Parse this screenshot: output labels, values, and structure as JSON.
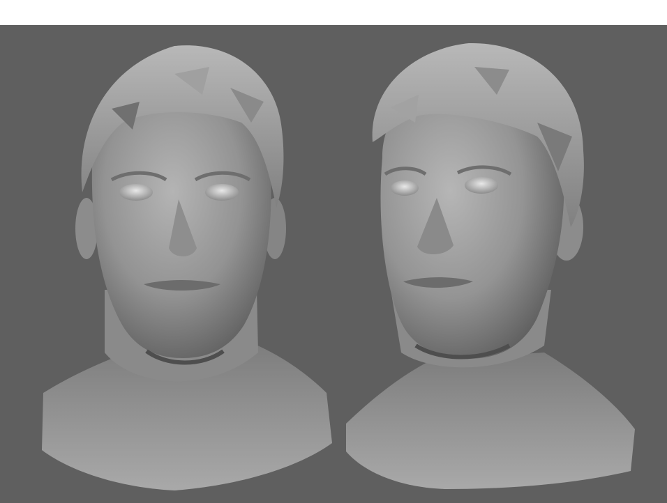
{
  "scene": {
    "background_color": "#5f5f5f",
    "top_strip_color": "#ffffff",
    "material_color": "#9a9a9a",
    "views": [
      {
        "id": "front",
        "label": ""
      },
      {
        "id": "three-quarter",
        "label": ""
      }
    ]
  }
}
